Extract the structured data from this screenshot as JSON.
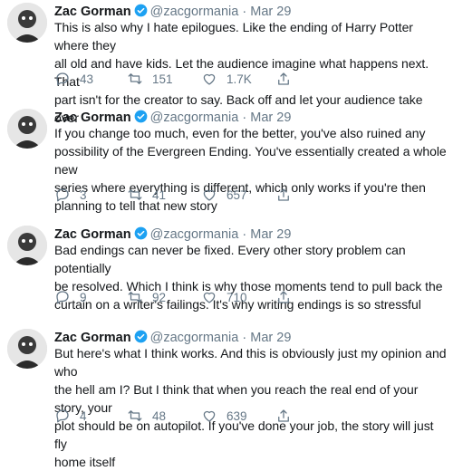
{
  "tweets": [
    {
      "name": "Zac Gorman",
      "handle": "@zacgormania",
      "separator": "·",
      "date": "Mar 29",
      "lines": [
        "This is also why I hate epilogues. Like the ending of Harry Potter where they",
        "all old and have kids. Let the audience imagine what happens next. That",
        "part isn't for the creator to say. Back off and let your audience take over"
      ],
      "replies": "43",
      "retweets": "151",
      "likes": "1.7K"
    },
    {
      "name": "Zac Gorman",
      "handle": "@zacgormania",
      "separator": "·",
      "date": "Mar 29",
      "lines": [
        "If you change too much, even for the better, you've also ruined any",
        "possibility of the Evergreen Ending. You've essentially created a whole new",
        "series where everything is different, which only works if you're then",
        "planning to tell that new story"
      ],
      "replies": "3",
      "retweets": "41",
      "likes": "657"
    },
    {
      "name": "Zac Gorman",
      "handle": "@zacgormania",
      "separator": "·",
      "date": "Mar 29",
      "lines": [
        "Bad endings can never be fixed. Every other story problem can potentially",
        "be resolved. Which I think is why those moments tend to pull back the",
        "curtain on a writer's failings. It's why writing endings is so stressful"
      ],
      "replies": "9",
      "retweets": "92",
      "likes": "710"
    },
    {
      "name": "Zac Gorman",
      "handle": "@zacgormania",
      "separator": "·",
      "date": "Mar 29",
      "lines": [
        "But here's what I think works. And this is obviously just my opinion and who",
        "the hell am I? But I think that when you reach the real end of your story, your",
        "plot should be on autopilot. If you've done your job, the story will just fly",
        "home itself"
      ],
      "replies": "4",
      "retweets": "48",
      "likes": "639"
    }
  ],
  "colors": {
    "text": "#14171a",
    "secondary": "#657786",
    "verified": "#1da1f2"
  },
  "icons": [
    "reply-icon",
    "retweet-icon",
    "like-icon",
    "share-icon",
    "verified-badge-icon"
  ]
}
